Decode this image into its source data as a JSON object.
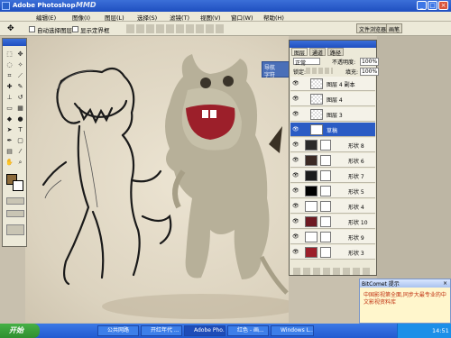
{
  "window": {
    "title": "Adobe Photoshop",
    "logo_text": "MMD"
  },
  "menu": [
    "编辑(E)",
    "图像(I)",
    "图层(L)",
    "选择(S)",
    "滤镜(T)",
    "视图(V)",
    "窗口(W)",
    "帮助(H)"
  ],
  "options_bar": {
    "auto_select_layer": "自动选择图层",
    "show_bounds": "显示定界框",
    "tab_file_browser": "文件浏览器",
    "tab_brushes": "画笔"
  },
  "layers_panel": {
    "tabs": [
      "图层",
      "通道",
      "路径"
    ],
    "blend_mode": "正常",
    "opacity_label": "不透明度:",
    "opacity_value": "100%",
    "lock_label": "锁定:",
    "fill_label": "填充:",
    "fill_value": "100%",
    "floating_label": "导航",
    "floating_tab": "字符",
    "layers": [
      {
        "name": "图层 4 副本",
        "selected": false
      },
      {
        "name": "图层 4",
        "selected": false
      },
      {
        "name": "图层 3",
        "selected": false
      },
      {
        "name": "草稿",
        "selected": true
      },
      {
        "name": "形状 8",
        "selected": false
      },
      {
        "name": "形状 6",
        "selected": false
      },
      {
        "name": "形状 7",
        "selected": false
      },
      {
        "name": "形状 5",
        "selected": false
      },
      {
        "name": "形状 4",
        "selected": false
      },
      {
        "name": "形状 10",
        "selected": false
      },
      {
        "name": "形状 9",
        "selected": false
      },
      {
        "name": "形状 3",
        "selected": false
      }
    ]
  },
  "popup": {
    "title": "BitComet  提示",
    "body": "中国影视第全面,同步大最专业的中文影视资料库"
  },
  "taskbar": {
    "start_label": "开始",
    "tasks": [
      "公共网路",
      "开红年代 ...",
      "Adobe Pho...",
      "红色 - 画...",
      "Windows L..."
    ],
    "clock": "14:51"
  },
  "colors": {
    "foreground_swatch": "#8b6a3a",
    "selected_layer": "#2a5bc4",
    "canvas_bg": "#e3dbc7"
  }
}
